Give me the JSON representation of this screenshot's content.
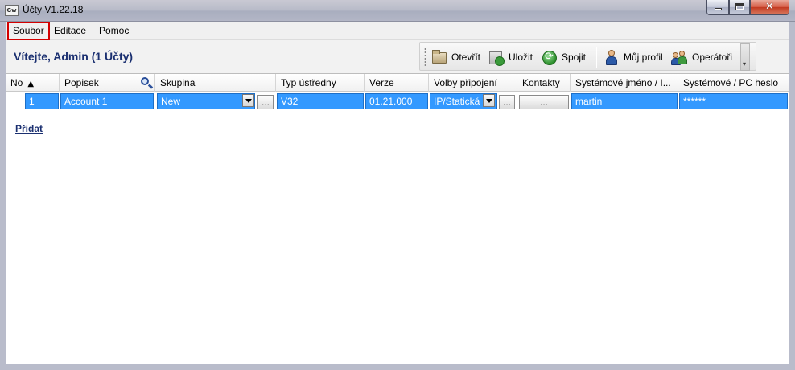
{
  "window": {
    "app_icon_text": "Gw",
    "title": "Účty V1.22.18",
    "close_glyph": "✕"
  },
  "menu": {
    "items": [
      {
        "first": "S",
        "rest": "oubor"
      },
      {
        "first": "E",
        "rest": "ditace"
      },
      {
        "first": "P",
        "rest": "omoc"
      }
    ]
  },
  "header": {
    "welcome": "Vítejte, Admin  (1 Účty)"
  },
  "toolbar": {
    "open": "Otevřít",
    "save": "Uložit",
    "connect": "Spojit",
    "profile": "Můj profil",
    "operators": "Operátoři",
    "more_glyph": "▾"
  },
  "grid": {
    "columns": [
      "No",
      "Popisek",
      "Skupina",
      "Typ ústředny",
      "Verze",
      "Volby připojení",
      "Kontakty",
      "Systémové jméno / I...",
      "Systémové / PC heslo"
    ],
    "sort_arrow": "▲",
    "rows": [
      {
        "no": "1",
        "label": "Account 1",
        "group": "New",
        "panel_type": "V32",
        "version": "01.21.000",
        "connection": "IP/Statická",
        "contacts": "...",
        "system_name": "martin",
        "password": "******"
      }
    ],
    "ellipsis": "..."
  },
  "add_link": "Přidat",
  "colors": {
    "selection": "#3399ff",
    "accent_text": "#1a2f70",
    "highlight_border": "#d40000"
  }
}
